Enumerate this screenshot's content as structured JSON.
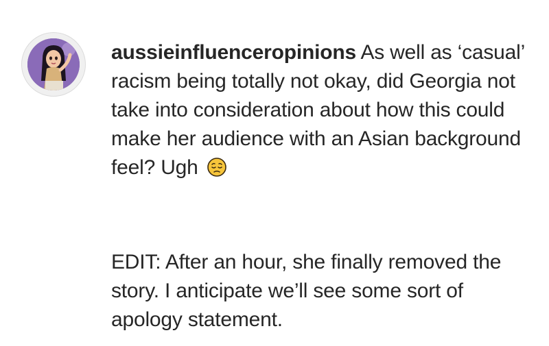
{
  "comment": {
    "username": "aussieinfluenceropinions",
    "text_line1": "As well as",
    "text_rest": "‘casual’ racism being totally not okay, did Georgia not take into consideration about how this could make her audience with an Asian background feel? Ugh",
    "emoji": "pensive-face-icon",
    "edit_text": "EDIT: After an hour, she finally removed the story. I anticipate we’ll see some sort of apology statement."
  },
  "colors": {
    "text": "#262626",
    "avatar_bg": "#7a5fa8",
    "emoji_face": "#f7c53b"
  }
}
